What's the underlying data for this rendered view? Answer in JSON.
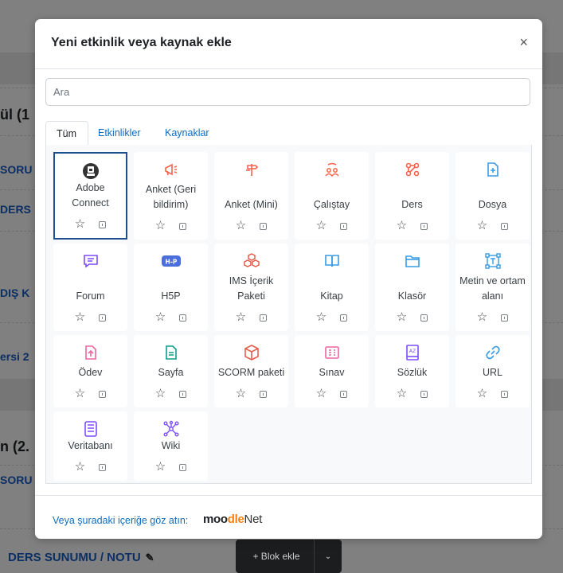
{
  "background": {
    "headings": [
      "ül (1",
      "n (2."
    ],
    "links": [
      "SORU",
      "DERS",
      "DIŞ K",
      "ersi 2",
      "SORU"
    ],
    "bottom_link": "DERS SUNUMU / NOTU",
    "block_button": "+ Blok ekle"
  },
  "modal": {
    "title": "Yeni etkinlik veya kaynak ekle",
    "close": "×",
    "search_placeholder": "Ara",
    "tabs": [
      "Tüm",
      "Etkinlikler",
      "Kaynaklar"
    ],
    "active_tab": "Tüm",
    "items": [
      {
        "label": "Adobe Connect",
        "icon": "adobe-connect-icon",
        "color": "#333333",
        "selected": true
      },
      {
        "label": "Anket (Geri bildirim)",
        "icon": "megaphone-icon",
        "color": "#f7634d"
      },
      {
        "label": "Anket (Mini)",
        "icon": "signpost-icon",
        "color": "#f7634d"
      },
      {
        "label": "Çalıştay",
        "icon": "workshop-icon",
        "color": "#f7634d"
      },
      {
        "label": "Ders",
        "icon": "lesson-icon",
        "color": "#f7634d"
      },
      {
        "label": "Dosya",
        "icon": "file-icon",
        "color": "#399be2"
      },
      {
        "label": "Forum",
        "icon": "forum-icon",
        "color": "#7c4dff"
      },
      {
        "label": "H5P",
        "icon": "h5p-icon",
        "color": "#4a6fdc"
      },
      {
        "label": "IMS İçerik Paketi",
        "icon": "ims-package-icon",
        "color": "#e45d4b"
      },
      {
        "label": "Kitap",
        "icon": "book-icon",
        "color": "#399be2"
      },
      {
        "label": "Klasör",
        "icon": "folder-icon",
        "color": "#399be2"
      },
      {
        "label": "Metin ve ortam alanı",
        "icon": "text-media-icon",
        "color": "#399be2"
      },
      {
        "label": "Ödev",
        "icon": "assignment-icon",
        "color": "#eb66a2"
      },
      {
        "label": "Sayfa",
        "icon": "page-icon",
        "color": "#0d9c8a"
      },
      {
        "label": "SCORM paketi",
        "icon": "scorm-icon",
        "color": "#e45d4b"
      },
      {
        "label": "Sınav",
        "icon": "quiz-icon",
        "color": "#eb66a2"
      },
      {
        "label": "Sözlük",
        "icon": "glossary-icon",
        "color": "#7c4dff"
      },
      {
        "label": "URL",
        "icon": "url-icon",
        "color": "#399be2"
      },
      {
        "label": "Veritabanı",
        "icon": "database-icon",
        "color": "#7c4dff"
      },
      {
        "label": "Wiki",
        "icon": "wiki-icon",
        "color": "#7c4dff"
      }
    ],
    "footer_text": "Veya şuradaki içeriğe göz atın:",
    "brand": {
      "part1": "moo",
      "part2": "dle",
      "part3": "Net"
    }
  }
}
